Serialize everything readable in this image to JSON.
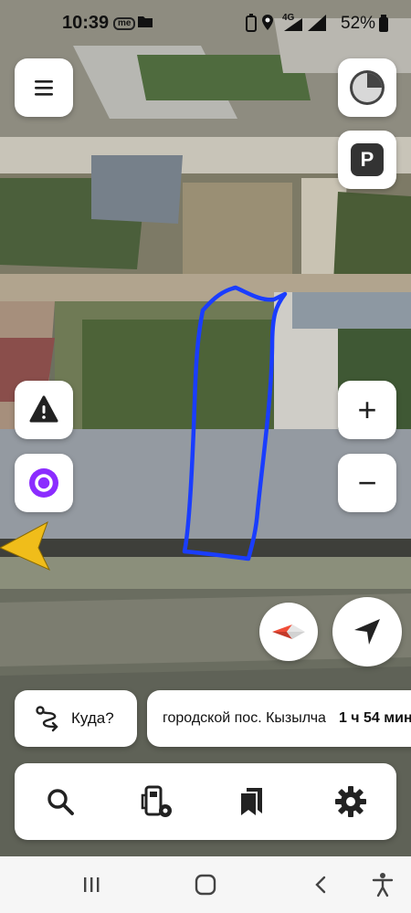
{
  "status_bar": {
    "time": "10:39",
    "notification_badge": "me",
    "network": "4G",
    "battery": "52%"
  },
  "map": {
    "drawn_outline_color": "#1a3dff",
    "parking_label": "P"
  },
  "controls": {
    "zoom_in_label": "+",
    "zoom_out_label": "−"
  },
  "route": {
    "where_label": "Куда?",
    "destination": "городской пос. Кызылча",
    "eta": "1 ч 54 мин"
  },
  "colors": {
    "alice_purple": "#8b2cff",
    "accent_red": "#f04d38",
    "user_arrow_yellow": "#f0bd1a"
  },
  "icons": {
    "menu": "menu-icon",
    "layers": "layers-icon",
    "parking": "parking-icon",
    "alert": "road-alert-icon",
    "alice": "alice-icon",
    "compass": "compass-icon",
    "locate": "locate-icon",
    "route": "route-icon",
    "search": "search-icon",
    "fuel": "fuel-icon",
    "bookmarks": "bookmark-icon",
    "settings": "gear-icon"
  }
}
